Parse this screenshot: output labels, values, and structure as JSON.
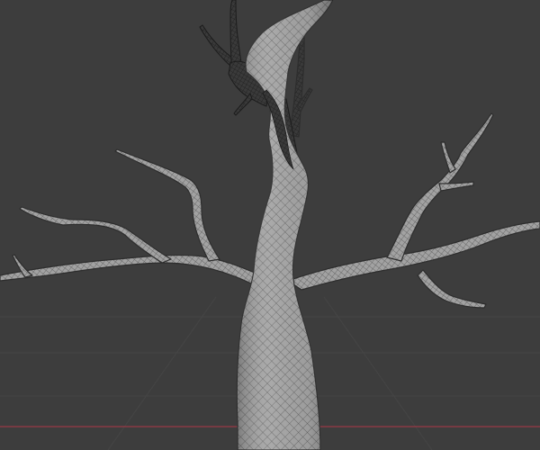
{
  "viewport": {
    "object": "tree-mesh",
    "shading": "wireframe-overlay",
    "colors": {
      "background": "#3d3d3d",
      "grid_line": "#454545",
      "x_axis": "#8a3a44",
      "mesh_fill": "#9e9e9e",
      "mesh_wire": "#4a4a4a",
      "mesh_dark": "#2a2a2a"
    }
  }
}
